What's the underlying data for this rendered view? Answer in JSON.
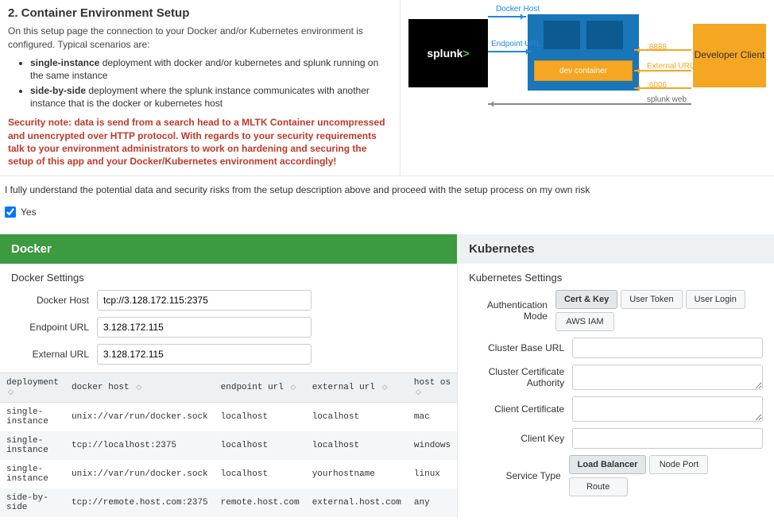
{
  "header": {
    "title": "2. Container Environment Setup",
    "intro": "On this setup page the connection to your Docker and/or Kubernetes environment is configured. Typical scenarios are:",
    "scenario1_b": "single-instance",
    "scenario1_t": " deployment with docker and/or kubernetes and splunk running on the same instance",
    "scenario2_b": "side-by-side",
    "scenario2_t": " deployment where the splunk instance communicates with another instance that is the docker or kubernetes host",
    "security": "Security note: data is send from a search head to a MLTK Container uncompressed and unencrypted over HTTP protocol. With regards to your security requirements talk to your environment administrators to work on hardening and securing the setup of this app and your Docker/Kubernetes environment accordingly!"
  },
  "diagram": {
    "docker_host": "Docker Host",
    "endpoint_url": "Endpoint URL",
    "external_url": "External URL",
    "splunk_web": "splunk web",
    "port8888": ":8888",
    "port6006": ":6006",
    "splunk": "splunk",
    "dev_container": "dev container",
    "dev_client": "Developer Client"
  },
  "consent": {
    "text": "I fully understand the potential data and security risks from the setup description above and proceed with the setup process on my own risk",
    "yes": "Yes"
  },
  "docker": {
    "title": "Docker",
    "settings": "Docker Settings",
    "labels": {
      "host": "Docker Host",
      "endpoint": "Endpoint URL",
      "external": "External URL"
    },
    "values": {
      "host": "tcp://3.128.172.115:2375",
      "endpoint": "3.128.172.115",
      "external": "3.128.172.115"
    },
    "columns": [
      "deployment",
      "docker host",
      "endpoint url",
      "external url",
      "host os"
    ],
    "rows": [
      [
        "single-instance",
        "unix://var/run/docker.sock",
        "localhost",
        "localhost",
        "mac"
      ],
      [
        "single-instance",
        "tcp://localhost:2375",
        "localhost",
        "localhost",
        "windows"
      ],
      [
        "single-instance",
        "unix://var/run/docker.sock",
        "localhost",
        "yourhostname",
        "linux"
      ],
      [
        "side-by-side",
        "tcp://remote.host.com:2375",
        "remote.host.com",
        "external.host.com",
        "any"
      ]
    ]
  },
  "k8s": {
    "title": "Kubernetes",
    "settings": "Kubernetes Settings",
    "labels": {
      "auth": "Authentication Mode",
      "base": "Cluster Base URL",
      "ca": "Cluster Certificate Authority",
      "cert": "Client Certificate",
      "key": "Client Key",
      "svc": "Service Type"
    },
    "auth_options": [
      "Cert & Key",
      "User Token",
      "User Login",
      "AWS IAM"
    ],
    "svc_options": [
      "Load Balancer",
      "Node Port",
      "Route"
    ]
  }
}
